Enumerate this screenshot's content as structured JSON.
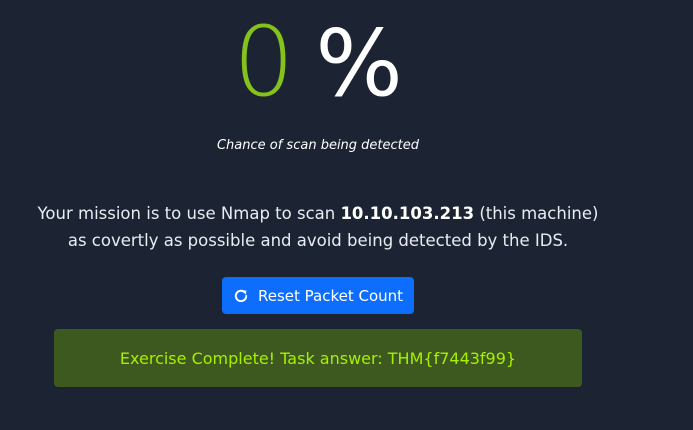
{
  "detection": {
    "value": "0",
    "unit": "%",
    "caption": "Chance of scan being detected",
    "value_color": "#86c21c"
  },
  "mission": {
    "prefix": "Your mission is to use Nmap to scan ",
    "target_ip": "10.10.103.213",
    "suffix_line1": " (this machine)",
    "line2": "as covertly as possible and avoid being detected by the IDS."
  },
  "reset_button": {
    "label": "Reset Packet Count",
    "icon": "refresh-icon",
    "color": "#0d6efd"
  },
  "result": {
    "message": "Exercise Complete! Task answer: THM{f7443f99}",
    "bg_color": "#3d5920",
    "text_color": "#a8f000"
  }
}
